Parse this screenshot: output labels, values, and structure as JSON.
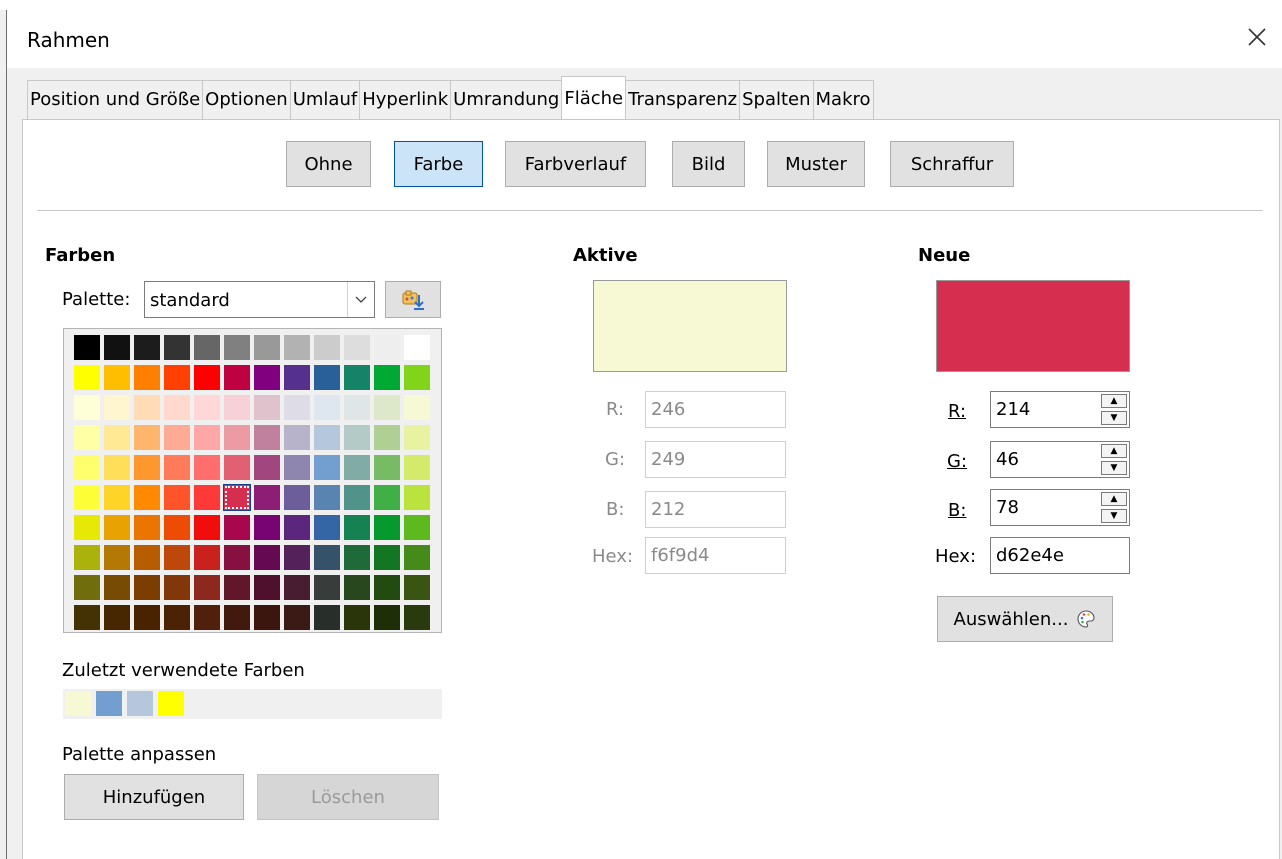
{
  "window": {
    "title": "Rahmen"
  },
  "tabs": [
    "Position und Größe",
    "Optionen",
    "Umlauf",
    "Hyperlink",
    "Umrandung",
    "Fläche",
    "Transparenz",
    "Spalten",
    "Makro"
  ],
  "active_tab": "Fläche",
  "fill_buttons": {
    "none": "Ohne",
    "color": "Farbe",
    "gradient": "Farbverlauf",
    "bitmap": "Bild",
    "pattern": "Muster",
    "hatch": "Schraffur"
  },
  "colors_section": {
    "heading": "Farben",
    "palette_label": "Palette:",
    "palette_value": "standard",
    "recent_label": "Zuletzt verwendete Farben",
    "customize_label": "Palette anpassen",
    "add_button": "Hinzufügen",
    "delete_button": "Löschen"
  },
  "palette": [
    [
      "#000000",
      "#111111",
      "#1c1c1c",
      "#333333",
      "#666666",
      "#808080",
      "#999999",
      "#b2b2b2",
      "#cccccc",
      "#dddddd",
      "#eeeeee",
      "#ffffff"
    ],
    [
      "#ffff00",
      "#ffbf00",
      "#ff8000",
      "#ff4000",
      "#ff0000",
      "#bf0041",
      "#800080",
      "#55308d",
      "#2a6099",
      "#158466",
      "#00a933",
      "#81d41a"
    ],
    [
      "#ffffd7",
      "#fff5ce",
      "#ffdbb6",
      "#ffd8ce",
      "#ffd7d7",
      "#f7d1d5",
      "#e0c2cd",
      "#dedce6",
      "#dee6ef",
      "#dee7e5",
      "#dde8cb",
      "#f6f9d4"
    ],
    [
      "#ffffa6",
      "#ffe994",
      "#ffb66c",
      "#ffaa95",
      "#ffa6a6",
      "#ec9ba4",
      "#bf819e",
      "#b7b3ca",
      "#b4c7dc",
      "#b3cac7",
      "#afd095",
      "#e8f2a1"
    ],
    [
      "#ffff6d",
      "#ffde59",
      "#ff972f",
      "#ff7b59",
      "#ff6d6d",
      "#e16173",
      "#a1467e",
      "#8e86ae",
      "#729fcf",
      "#81aca6",
      "#77bc65",
      "#d4ea6b"
    ],
    [
      "#ffff38",
      "#ffd428",
      "#ff8a00",
      "#ff5429",
      "#ff3838",
      "#d62e4e",
      "#8d1d75",
      "#6b5e9b",
      "#5983b0",
      "#50938a",
      "#3faf46",
      "#bbe33d"
    ],
    [
      "#e6e905",
      "#e8a202",
      "#ea7500",
      "#ed4c05",
      "#f10d0c",
      "#a7074b",
      "#780373",
      "#5b277d",
      "#3465a4",
      "#168253",
      "#069a2e",
      "#5eb91e"
    ],
    [
      "#acb20c",
      "#b47804",
      "#b85c00",
      "#be480a",
      "#c9211e",
      "#861141",
      "#650953",
      "#55215b",
      "#355269",
      "#1e6a39",
      "#127622",
      "#468a1a"
    ],
    [
      "#706e0c",
      "#784b04",
      "#7b3d00",
      "#813709",
      "#8d281e",
      "#611729",
      "#4e102d",
      "#481d32",
      "#383d3c",
      "#28471f",
      "#224b12",
      "#395511"
    ],
    [
      "#443205",
      "#472702",
      "#492300",
      "#4b2204",
      "#50200c",
      "#41190d",
      "#3b160e",
      "#3a1a14",
      "#282e2a",
      "#2a3609",
      "#1e2e06",
      "#293a0f"
    ]
  ],
  "selected_swatch": {
    "row": 5,
    "col": 5
  },
  "recent_colors": [
    "#f6f9d4",
    "#729fcf",
    "#b4c7dc",
    "#ffff00"
  ],
  "active": {
    "heading": "Aktive",
    "color": "#f6f9d4",
    "r_label": "R:",
    "r": "246",
    "g_label": "G:",
    "g": "249",
    "b_label": "B:",
    "b": "212",
    "hex_label": "Hex:",
    "hex": "f6f9d4"
  },
  "new": {
    "heading": "Neue",
    "color": "#d62e4e",
    "r_label": "R:",
    "r": "214",
    "g_label": "G:",
    "g": "46",
    "b_label": "B:",
    "b": "78",
    "hex_label": "Hex:",
    "hex": "d62e4e",
    "pick_button": "Auswählen..."
  }
}
